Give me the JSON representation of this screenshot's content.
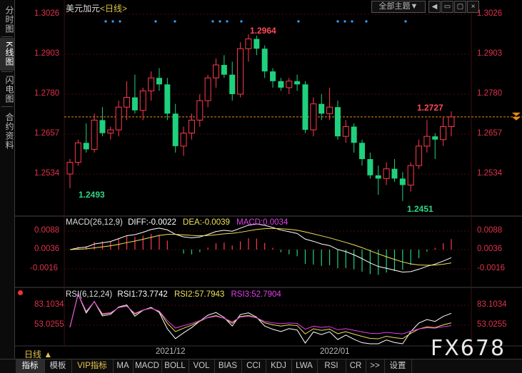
{
  "left_tabs": [
    "分时图",
    "K线图",
    "闪电图",
    "合约资料"
  ],
  "header": {
    "symbol": "美元加元",
    "period": "<日线>",
    "theme_label": "全部主题▼"
  },
  "price_axis": {
    "labels": [
      "1.3026",
      "1.2903",
      "1.2780",
      "1.2657",
      "1.2534"
    ]
  },
  "macd": {
    "title": "MACD(26,12,9)",
    "diff": "DIFF:-0.0022",
    "dea": "DEA:-0.0039",
    "macd": "MACD:0.0034",
    "labels": [
      "0.0088",
      "0.0036",
      "-0.0016"
    ]
  },
  "rsi": {
    "title": "RSI(6,12,24)",
    "rsi1": "RSI1:73.7742",
    "rsi2": "RSI2:57.7943",
    "rsi3": "RSI3:52.7904",
    "labels": [
      "83.1034",
      "53.0255"
    ]
  },
  "x_labels": [
    "2021/12",
    "2022/01"
  ],
  "period_label": "日线 ▲",
  "watermark": "FX678",
  "annotations": {
    "high": "1.2964",
    "low_left": "1.2493",
    "low": "1.2451",
    "last": "1.2727"
  },
  "bottom_tabs": [
    "指标",
    "模板",
    "VIP指标",
    "MA",
    "MACD",
    "BOLL",
    "VOL",
    "BIAS",
    "CCI",
    "KDJ",
    "LWA",
    "RSI",
    "CR",
    ">>",
    "设置"
  ],
  "colors": {
    "up": "#ff3a4c",
    "down": "#1fd17c",
    "grid": "#4a0d0d",
    "last_price": "#e88a18",
    "dif": "#ffffff",
    "dea": "#f0e05a",
    "macd_label": "#e040e8"
  },
  "chart_data": {
    "type": "candlestick",
    "candles": [
      [
        1.2534,
        1.258,
        1.249,
        1.257
      ],
      [
        1.257,
        1.264,
        1.256,
        1.263
      ],
      [
        1.263,
        1.269,
        1.26,
        1.261
      ],
      [
        1.261,
        1.272,
        1.26,
        1.27
      ],
      [
        1.27,
        1.274,
        1.265,
        1.266
      ],
      [
        1.266,
        1.268,
        1.264,
        1.267
      ],
      [
        1.267,
        1.276,
        1.265,
        1.274
      ],
      [
        1.274,
        1.282,
        1.27,
        1.277
      ],
      [
        1.277,
        1.284,
        1.272,
        1.273
      ],
      [
        1.273,
        1.28,
        1.27,
        1.279
      ],
      [
        1.279,
        1.285,
        1.276,
        1.283
      ],
      [
        1.283,
        1.286,
        1.279,
        1.281
      ],
      [
        1.281,
        1.283,
        1.27,
        1.272
      ],
      [
        1.272,
        1.275,
        1.26,
        1.262
      ],
      [
        1.262,
        1.268,
        1.259,
        1.266
      ],
      [
        1.266,
        1.272,
        1.264,
        1.27
      ],
      [
        1.27,
        1.278,
        1.268,
        1.276
      ],
      [
        1.276,
        1.284,
        1.274,
        1.283
      ],
      [
        1.283,
        1.289,
        1.28,
        1.287
      ],
      [
        1.287,
        1.29,
        1.283,
        1.284
      ],
      [
        1.284,
        1.288,
        1.276,
        1.278
      ],
      [
        1.278,
        1.294,
        1.277,
        1.292
      ],
      [
        1.292,
        1.2964,
        1.288,
        1.295
      ],
      [
        1.295,
        1.296,
        1.29,
        1.292
      ],
      [
        1.292,
        1.293,
        1.283,
        1.285
      ],
      [
        1.285,
        1.286,
        1.28,
        1.282
      ],
      [
        1.282,
        1.283,
        1.279,
        1.28
      ],
      [
        1.28,
        1.283,
        1.278,
        1.282
      ],
      [
        1.282,
        1.284,
        1.279,
        1.281
      ],
      [
        1.281,
        1.282,
        1.266,
        1.267
      ],
      [
        1.267,
        1.277,
        1.265,
        1.275
      ],
      [
        1.275,
        1.278,
        1.27,
        1.272
      ],
      [
        1.272,
        1.28,
        1.27,
        1.274
      ],
      [
        1.274,
        1.276,
        1.264,
        1.265
      ],
      [
        1.265,
        1.27,
        1.263,
        1.268
      ],
      [
        1.268,
        1.269,
        1.26,
        1.263
      ],
      [
        1.263,
        1.264,
        1.256,
        1.258
      ],
      [
        1.258,
        1.26,
        1.252,
        1.253
      ],
      [
        1.253,
        1.256,
        1.247,
        1.252
      ],
      [
        1.252,
        1.257,
        1.25,
        1.255
      ],
      [
        1.255,
        1.258,
        1.251,
        1.252
      ],
      [
        1.252,
        1.254,
        1.2451,
        1.25
      ],
      [
        1.25,
        1.257,
        1.248,
        1.256
      ],
      [
        1.256,
        1.264,
        1.255,
        1.262
      ],
      [
        1.262,
        1.27,
        1.26,
        1.265
      ],
      [
        1.265,
        1.266,
        1.258,
        1.264
      ],
      [
        1.264,
        1.271,
        1.262,
        1.268
      ],
      [
        1.268,
        1.2727,
        1.265,
        1.271
      ]
    ],
    "ymin": 1.244,
    "ymax": 1.304
  }
}
